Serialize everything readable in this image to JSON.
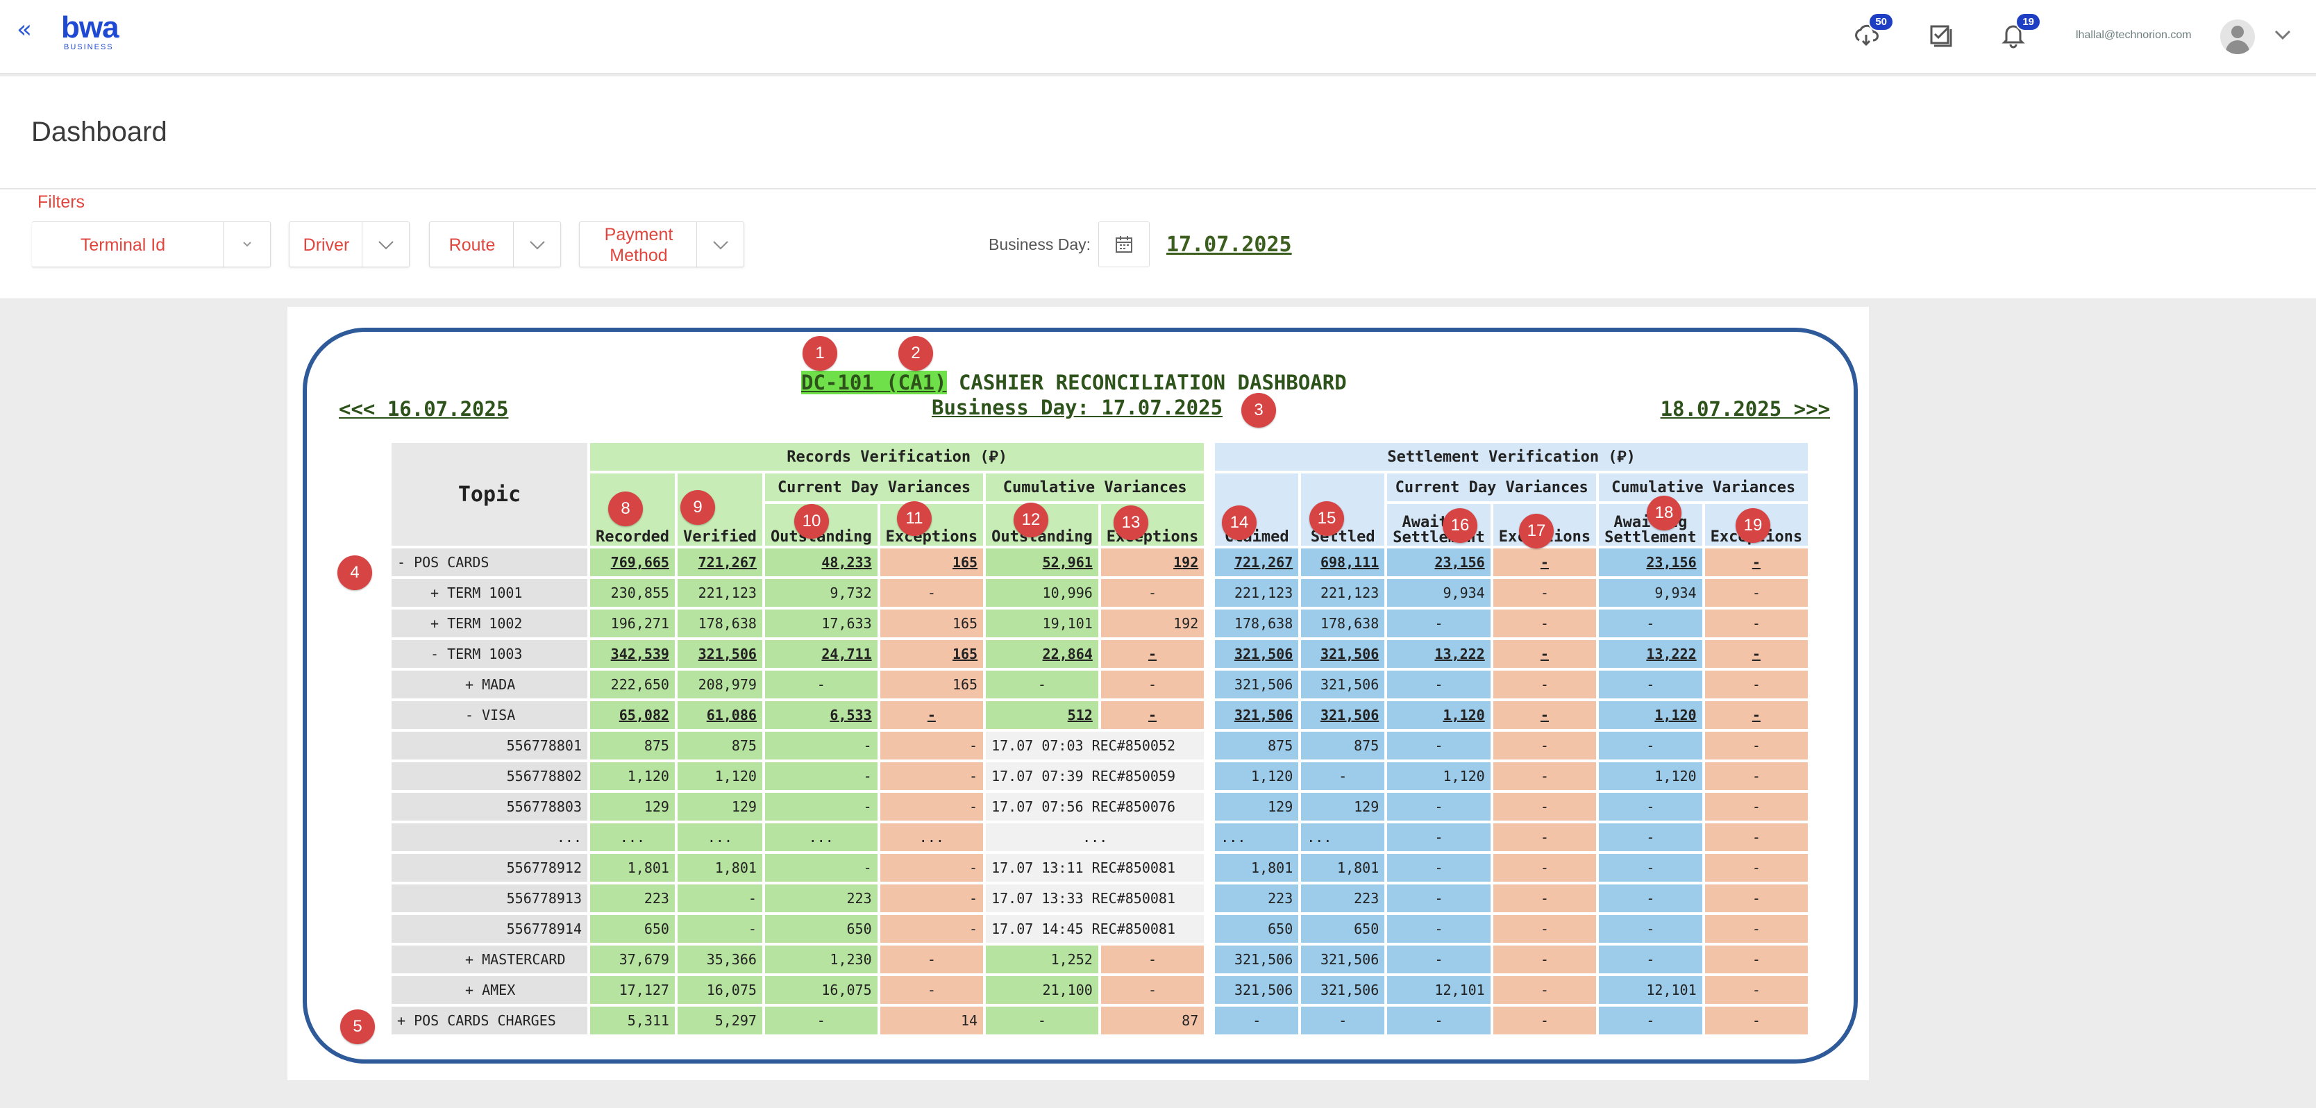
{
  "header": {
    "collapse_symbol": "«",
    "logo_text": "bwa",
    "logo_subtext": "BUSINESS",
    "downloads_badge": "50",
    "notifications_badge": "19",
    "user_email": "lhallal@technorion.com"
  },
  "page": {
    "title": "Dashboard"
  },
  "filters": {
    "label": "Filters",
    "terminal_id": "Terminal Id",
    "driver": "Driver",
    "route": "Route",
    "payment_method": "Payment Method",
    "business_day_label": "Business Day:",
    "business_day_value": "17.07.2025"
  },
  "dashboard": {
    "title_highlight": "DC-101 (CA1)",
    "title_rest": " CASHIER RECONCILIATION DASHBOARD",
    "business_day": "Business Day: 17.07.2025",
    "prev_day": "<<< 16.07.2025",
    "next_day": "18.07.2025 >>>",
    "callouts": [
      "1",
      "2",
      "3",
      "4",
      "5",
      "8",
      "9",
      "10",
      "11",
      "12",
      "13",
      "14",
      "15",
      "16",
      "17",
      "18",
      "19"
    ],
    "headers": {
      "topic": "Topic",
      "records_group": "Records Verification (⃁)",
      "settlement_group": "Settlement Verification (⃁)",
      "current_day_variances": "Current Day Variances",
      "cumulative_variances": "Cumulative Variances",
      "recorded": "Recorded",
      "verified": "Verified",
      "outstanding": "Outstanding",
      "exceptions": "Exceptions",
      "claimed": "Claimed",
      "settled": "Settled",
      "awaiting_1": "Awaiting",
      "settlement_1": "Settlement"
    },
    "rows": [
      {
        "topic": "- POS CARDS",
        "cells": [
          "769,665",
          "721,267",
          "48,233",
          "165",
          "52,961",
          "192",
          "721,267",
          "698,111",
          "23,156",
          "-",
          "23,156",
          "-"
        ]
      },
      {
        "topic": "+ TERM 1001",
        "cells": [
          "230,855",
          "221,123",
          "9,732",
          "-",
          "10,996",
          "-",
          "221,123",
          "221,123",
          "9,934",
          "-",
          "9,934",
          "-"
        ]
      },
      {
        "topic": "+ TERM 1002",
        "cells": [
          "196,271",
          "178,638",
          "17,633",
          "165",
          "19,101",
          "192",
          "178,638",
          "178,638",
          "-",
          "-",
          "-",
          "-"
        ]
      },
      {
        "topic": "- TERM 1003",
        "cells": [
          "342,539",
          "321,506",
          "24,711",
          "165",
          "22,864",
          "-",
          "321,506",
          "321,506",
          "13,222",
          "-",
          "13,222",
          "-"
        ]
      },
      {
        "topic": "+ MADA",
        "cells": [
          "222,650",
          "208,979",
          "-",
          "165",
          "-",
          "-",
          "321,506",
          "321,506",
          "-",
          "-",
          "-",
          "-"
        ]
      },
      {
        "topic": "- VISA",
        "cells": [
          "65,082",
          "61,086",
          "6,533",
          "-",
          "512",
          "-",
          "321,506",
          "321,506",
          "1,120",
          "-",
          "1,120",
          "-"
        ]
      },
      {
        "topic": "556778801",
        "cells": [
          "875",
          "875",
          "-",
          "-",
          "17.07 07:03 REC#850052",
          "875",
          "875",
          "-",
          "-",
          "-",
          "-"
        ]
      },
      {
        "topic": "556778802",
        "cells": [
          "1,120",
          "1,120",
          "-",
          "-",
          "17.07 07:39 REC#850059",
          "1,120",
          "-",
          "1,120",
          "-",
          "1,120",
          "-"
        ]
      },
      {
        "topic": "556778803",
        "cells": [
          "129",
          "129",
          "-",
          "-",
          "17.07 07:56 REC#850076",
          "129",
          "129",
          "-",
          "-",
          "-",
          "-"
        ]
      },
      {
        "topic": "...",
        "cells": [
          "...",
          "...",
          "...",
          "...",
          "...",
          "...",
          "...",
          "-",
          "-",
          "-",
          "-"
        ]
      },
      {
        "topic": "556778912",
        "cells": [
          "1,801",
          "1,801",
          "-",
          "-",
          "17.07 13:11 REC#850081",
          "1,801",
          "1,801",
          "-",
          "-",
          "-",
          "-"
        ]
      },
      {
        "topic": "556778913",
        "cells": [
          "223",
          "-",
          "223",
          "-",
          "17.07 13:33 REC#850081",
          "223",
          "223",
          "-",
          "-",
          "-",
          "-"
        ]
      },
      {
        "topic": "556778914",
        "cells": [
          "650",
          "-",
          "650",
          "-",
          "17.07 14:45 REC#850081",
          "650",
          "650",
          "-",
          "-",
          "-",
          "-"
        ]
      },
      {
        "topic": "+ MASTERCARD",
        "cells": [
          "37,679",
          "35,366",
          "1,230",
          "-",
          "1,252",
          "-",
          "321,506",
          "321,506",
          "-",
          "-",
          "-",
          "-"
        ]
      },
      {
        "topic": "+ AMEX",
        "cells": [
          "17,127",
          "16,075",
          "16,075",
          "-",
          "21,100",
          "-",
          "321,506",
          "321,506",
          "12,101",
          "-",
          "12,101",
          "-"
        ]
      },
      {
        "topic": "+ POS CARDS CHARGES",
        "cells": [
          "5,311",
          "5,297",
          "-",
          "14",
          "-",
          "87",
          "-",
          "-",
          "-",
          "-",
          "-",
          "-"
        ]
      }
    ]
  },
  "colors": {
    "brand": "#1f49d3",
    "accent_red": "#e1463e",
    "title_green": "#2d531b",
    "frame_blue": "#2f5a9a"
  }
}
